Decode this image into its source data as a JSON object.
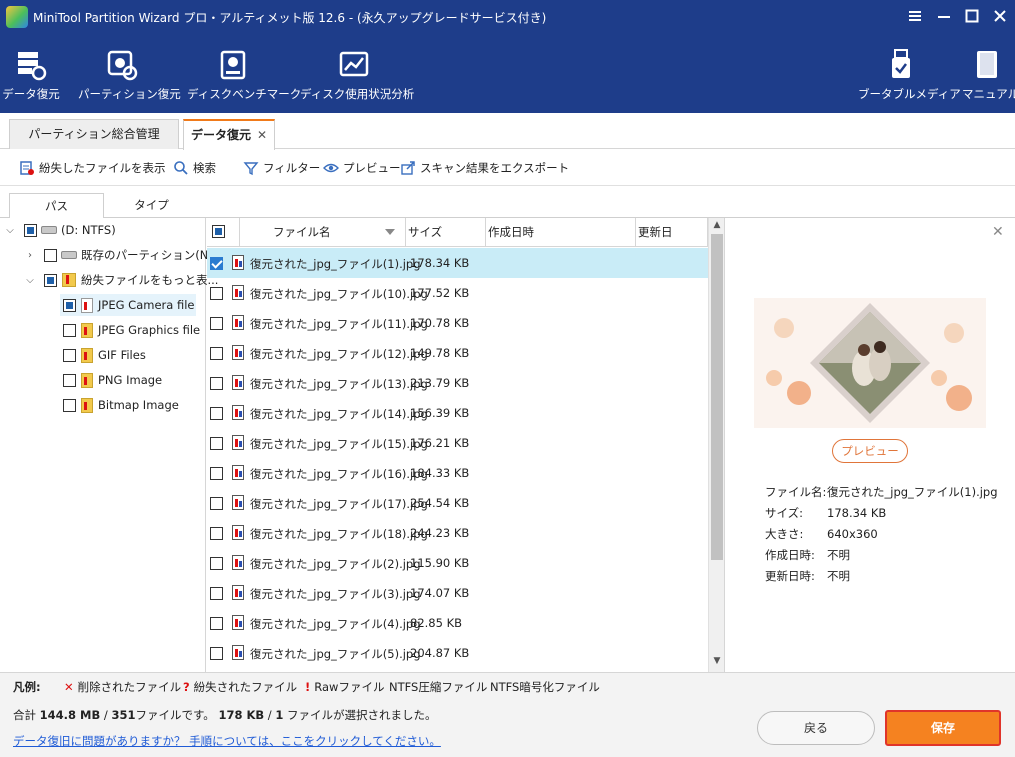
{
  "window": {
    "title": "MiniTool Partition Wizard プロ・アルティメット版 12.6 - (永久アップグレードサービス付き)",
    "controls": [
      "menu-icon",
      "minimize-icon",
      "maximize-icon",
      "close-icon"
    ]
  },
  "ribbon": {
    "left": [
      {
        "label": "データ復元",
        "icon": "data-recovery-icon"
      },
      {
        "label": "パーティション復元",
        "icon": "partition-recovery-icon"
      },
      {
        "label": "ディスクベンチマーク",
        "icon": "disk-benchmark-icon"
      },
      {
        "label": "ディスク使用状況分析",
        "icon": "space-analyzer-icon"
      }
    ],
    "right": [
      {
        "label": "ブータブルメディア",
        "icon": "bootable-media-icon"
      },
      {
        "label": "マニュアル",
        "icon": "manual-icon"
      }
    ]
  },
  "tabs": [
    {
      "label": "パーティション総合管理",
      "active": false
    },
    {
      "label": "データ復元",
      "active": true,
      "close": "✕"
    }
  ],
  "toolbar": {
    "show_lost": "紛失したファイルを表示",
    "search": "検索",
    "filter": "フィルター",
    "preview": "プレビュー",
    "export": "スキャン結果をエクスポート"
  },
  "subtabs": {
    "path": "パス",
    "type": "タイプ"
  },
  "tree": {
    "root": "(D: NTFS)",
    "existing": "既存のパーティション(N...",
    "lost": "紛失ファイルをもっと表...",
    "children": [
      {
        "label": "JPEG Camera file",
        "selected": true
      },
      {
        "label": "JPEG Graphics file",
        "selected": false
      },
      {
        "label": "GIF Files",
        "selected": false
      },
      {
        "label": "PNG Image",
        "selected": false
      },
      {
        "label": "Bitmap Image",
        "selected": false
      }
    ]
  },
  "list": {
    "columns": {
      "name": "ファイル名",
      "size": "サイズ",
      "created": "作成日時",
      "modified": "更新日"
    },
    "rows": [
      {
        "name": "復元された_jpg_ファイル(1).jpg",
        "size": "178.34 KB",
        "checked": true
      },
      {
        "name": "復元された_jpg_ファイル(10).jpg",
        "size": "177.52 KB",
        "checked": false
      },
      {
        "name": "復元された_jpg_ファイル(11).jpg",
        "size": "170.78 KB",
        "checked": false
      },
      {
        "name": "復元された_jpg_ファイル(12).jpg",
        "size": "149.78 KB",
        "checked": false
      },
      {
        "name": "復元された_jpg_ファイル(13).jpg",
        "size": "213.79 KB",
        "checked": false
      },
      {
        "name": "復元された_jpg_ファイル(14).jpg",
        "size": "156.39 KB",
        "checked": false
      },
      {
        "name": "復元された_jpg_ファイル(15).jpg",
        "size": "176.21 KB",
        "checked": false
      },
      {
        "name": "復元された_jpg_ファイル(16).jpg",
        "size": "184.33 KB",
        "checked": false
      },
      {
        "name": "復元された_jpg_ファイル(17).jpg",
        "size": "254.54 KB",
        "checked": false
      },
      {
        "name": "復元された_jpg_ファイル(18).jpg",
        "size": "244.23 KB",
        "checked": false
      },
      {
        "name": "復元された_jpg_ファイル(2).jpg",
        "size": "115.90 KB",
        "checked": false
      },
      {
        "name": "復元された_jpg_ファイル(3).jpg",
        "size": "174.07 KB",
        "checked": false
      },
      {
        "name": "復元された_jpg_ファイル(4).jpg",
        "size": "82.85 KB",
        "checked": false
      },
      {
        "name": "復元された_jpg_ファイル(5).jpg",
        "size": "204.87 KB",
        "checked": false
      }
    ]
  },
  "preview": {
    "close": "✕",
    "button": "プレビュー",
    "info": [
      {
        "k": "ファイル名:",
        "v": "復元された_jpg_ファイル(1).jpg"
      },
      {
        "k": "サイズ:",
        "v": "178.34 KB"
      },
      {
        "k": "大きさ:",
        "v": "640x360"
      },
      {
        "k": "作成日時:",
        "v": "不明"
      },
      {
        "k": "更新日時:",
        "v": "不明"
      }
    ]
  },
  "legend": {
    "title": "凡例:",
    "deleted": "削除されたファイル",
    "lost": "紛失されたファイル",
    "raw": "Rawファイル",
    "ntfs_comp": "NTFS圧縮ファイル",
    "ntfs_enc": "NTFS暗号化ファイル",
    "deleted_mark": "✕",
    "lost_mark": "?",
    "raw_mark": "!"
  },
  "status": {
    "p1": "合計 ",
    "total": "144.8 MB",
    "p2": " / ",
    "count": "351",
    "p3": "ファイルです。 ",
    "sel_size": "178 KB",
    "p4": " / ",
    "sel_count": "1",
    "p5": " ファイルが選択されました。"
  },
  "help_link": "データ復旧に問題がありますか？ 手順については、ここをクリックしてください。",
  "buttons": {
    "back": "戻る",
    "save": "保存"
  },
  "colors": {
    "titlebar": "#1e3d8a",
    "accent": "#f58220",
    "link": "#1f5bd6",
    "selected_row": "#c9ecf7"
  }
}
